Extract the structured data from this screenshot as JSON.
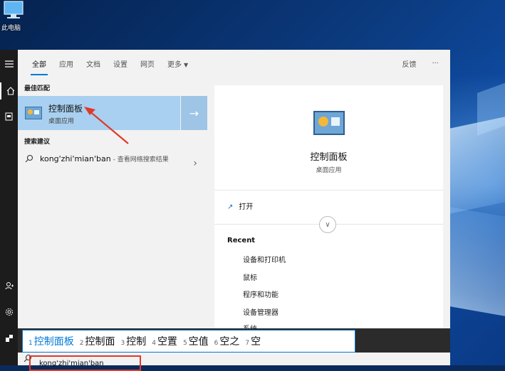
{
  "desktop": {
    "icon_label": "此电脑"
  },
  "rail": {
    "icons": [
      "menu-icon",
      "home-icon",
      "document-icon",
      "user-icon",
      "settings-icon",
      "feedback-icon"
    ]
  },
  "tabs": [
    {
      "label": "全部"
    },
    {
      "label": "应用"
    },
    {
      "label": "文档"
    },
    {
      "label": "设置"
    },
    {
      "label": "网页"
    },
    {
      "label": "更多"
    }
  ],
  "header_right": {
    "feedback": "反馈",
    "more": "···"
  },
  "best_match": {
    "section": "最佳匹配",
    "title": "控制面板",
    "subtitle": "桌面应用"
  },
  "suggestions": {
    "section": "搜索建议",
    "query": "kong'zhi'mian'ban",
    "suffix": " - 查看网络搜索结果"
  },
  "preview": {
    "title": "控制面板",
    "subtitle": "桌面应用",
    "open_label": "打开",
    "recent_label": "Recent",
    "recent_items": [
      "设备和打印机",
      "鼠标",
      "程序和功能",
      "设备管理器",
      "系统"
    ]
  },
  "ime": {
    "candidates": [
      {
        "n": "1",
        "text": "控制面板"
      },
      {
        "n": "2",
        "text": "控制面"
      },
      {
        "n": "3",
        "text": "控制"
      },
      {
        "n": "4",
        "text": "空置"
      },
      {
        "n": "5",
        "text": "空值"
      },
      {
        "n": "6",
        "text": "空之"
      },
      {
        "n": "7",
        "text": "空"
      }
    ]
  },
  "search": {
    "value": "kong'zhi'mian'ban"
  },
  "colors": {
    "accent": "#0078d7",
    "highlight": "#a9d0f0",
    "annotation": "#e0392b"
  }
}
